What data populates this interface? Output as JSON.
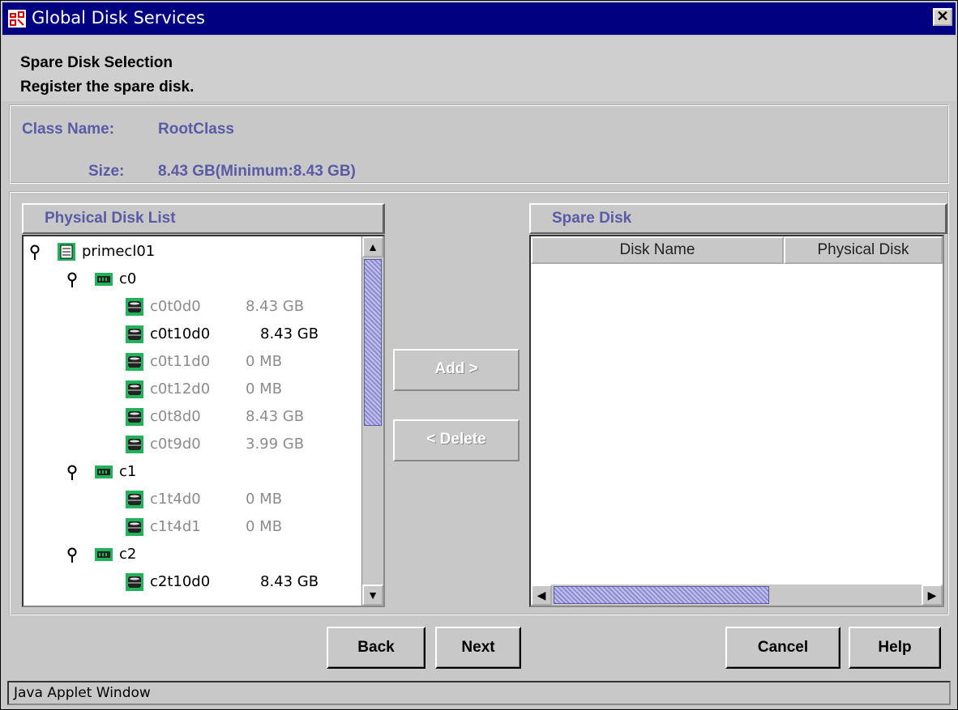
{
  "window": {
    "title": "Global Disk Services",
    "close_glyph": "✕"
  },
  "header": {
    "heading": "Spare Disk Selection",
    "subheading": "Register the spare disk."
  },
  "info": {
    "class_label": "Class Name:",
    "class_value": "RootClass",
    "size_label": "Size:",
    "size_value": "8.43 GB(Minimum:8.43 GB)"
  },
  "physical_list": {
    "title": "Physical Disk List",
    "nodes": [
      {
        "name": "primecl01",
        "size": "",
        "level": 0,
        "type": "node",
        "enabled": true
      },
      {
        "name": "c0",
        "size": "",
        "level": 1,
        "type": "controller",
        "enabled": true
      },
      {
        "name": "c0t0d0",
        "size": "8.43 GB",
        "level": 2,
        "type": "disk",
        "enabled": false
      },
      {
        "name": "c0t10d0",
        "size": "8.43 GB",
        "level": 2,
        "type": "disk",
        "enabled": true
      },
      {
        "name": "c0t11d0",
        "size": "0 MB",
        "level": 2,
        "type": "disk",
        "enabled": false
      },
      {
        "name": "c0t12d0",
        "size": "0 MB",
        "level": 2,
        "type": "disk",
        "enabled": false
      },
      {
        "name": "c0t8d0",
        "size": "8.43 GB",
        "level": 2,
        "type": "disk",
        "enabled": false
      },
      {
        "name": "c0t9d0",
        "size": "3.99 GB",
        "level": 2,
        "type": "disk",
        "enabled": false
      },
      {
        "name": "c1",
        "size": "",
        "level": 1,
        "type": "controller",
        "enabled": true
      },
      {
        "name": "c1t4d0",
        "size": "0 MB",
        "level": 2,
        "type": "disk",
        "enabled": false
      },
      {
        "name": "c1t4d1",
        "size": "0 MB",
        "level": 2,
        "type": "disk",
        "enabled": false
      },
      {
        "name": "c2",
        "size": "",
        "level": 1,
        "type": "controller",
        "enabled": true
      },
      {
        "name": "c2t10d0",
        "size": "8.43 GB",
        "level": 2,
        "type": "disk",
        "enabled": true
      }
    ]
  },
  "actions": {
    "add": "Add >",
    "delete": "< Delete"
  },
  "spare_disk": {
    "title": "Spare Disk",
    "col_disk_name": "Disk Name",
    "col_physical_disk": "Physical Disk",
    "rows": []
  },
  "buttons": {
    "back": "Back",
    "next": "Next",
    "cancel": "Cancel",
    "help": "Help"
  },
  "status": "Java Applet Window",
  "icons": {
    "app": "gds-app-icon",
    "node": "server-node-icon",
    "controller": "controller-icon",
    "disk": "disk-icon",
    "expand": "tree-expand-pin-icon",
    "scroll_up": "▲",
    "scroll_down": "▼",
    "scroll_left": "◀",
    "scroll_right": "▶"
  },
  "colors": {
    "title_bar": "#000080",
    "section_text": "#5a5aa6",
    "icon_green": "#22b35a",
    "disabled_text": "#8c8c8c"
  }
}
